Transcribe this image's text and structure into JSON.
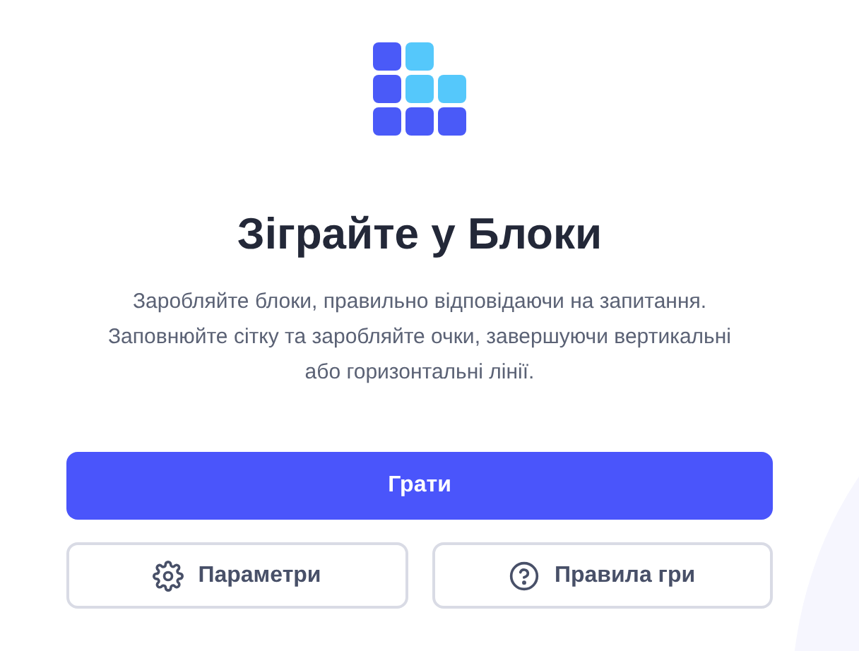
{
  "title": "Зіграйте у Блоки",
  "description": "Заробляйте блоки, правильно відповідаючи на запитання.\nЗаповнюйте сітку та заробляйте очки, завершуючи вертикальні\nабо горизонтальні лінії.",
  "primary_button": {
    "label": "Грати"
  },
  "buttons": [
    {
      "label": "Параметри",
      "kind": "settings"
    },
    {
      "label": "Правила гри",
      "kind": "help"
    }
  ]
}
